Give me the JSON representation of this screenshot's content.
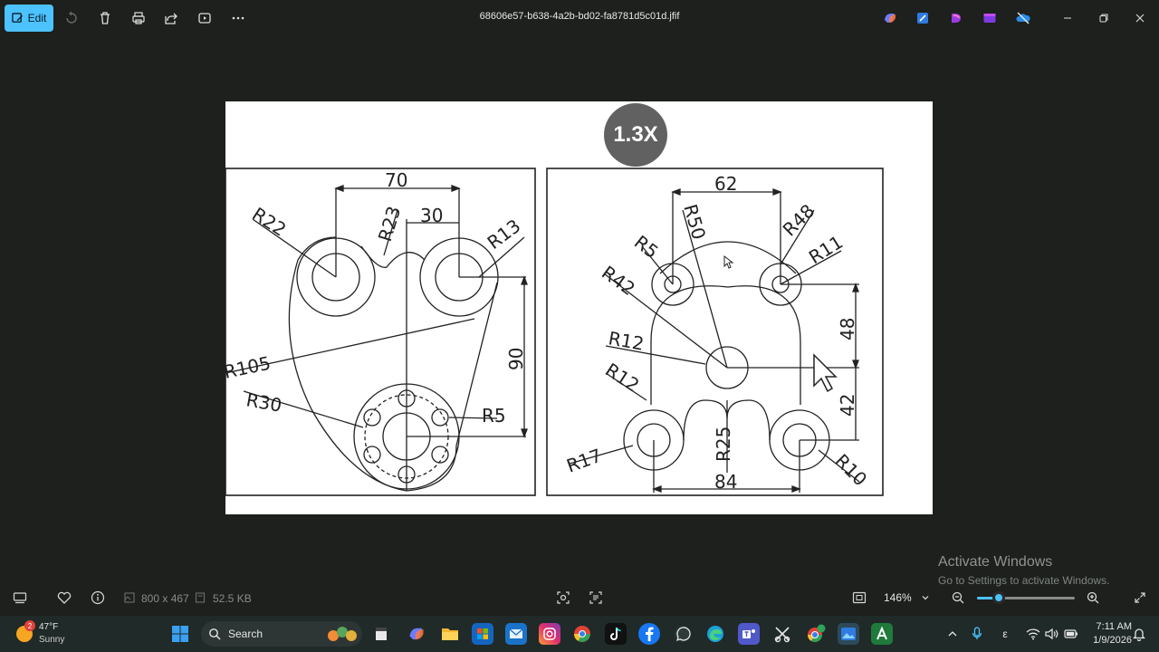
{
  "window": {
    "title": "68606e57-b638-4a2b-bd02-fa8781d5c01d.jfif"
  },
  "toolbar": {
    "edit_label": "Edit"
  },
  "overlay": {
    "zoom_badge": "1.3X"
  },
  "drawing": {
    "left": {
      "dims": [
        "70",
        "30",
        "90"
      ],
      "radii": [
        "R22",
        "R23",
        "R13",
        "R105",
        "R30",
        "R5"
      ]
    },
    "right": {
      "dims": [
        "62",
        "48",
        "42",
        "84"
      ],
      "radii": [
        "R50",
        "R48",
        "R5",
        "R11",
        "R42",
        "R12",
        "R12",
        "R25",
        "R17",
        "R10"
      ]
    }
  },
  "watermark": {
    "title": "Activate Windows",
    "subtitle": "Go to Settings to activate Windows."
  },
  "statusbar": {
    "dimensions": "800 x 467",
    "file_size": "52.5 KB",
    "zoom_value": "146%",
    "zoom_level": 0.22
  },
  "taskbar": {
    "weather_badge": "2",
    "weather_temp": "47°F",
    "weather_cond": "Sunny",
    "search_label": "Search",
    "time": "7:11 AM",
    "date": "1/9/2026",
    "lang_char": "ε"
  },
  "colors": {
    "accent": "#4cc2ff",
    "background": "#1d201c",
    "taskbar": "#202a28"
  }
}
